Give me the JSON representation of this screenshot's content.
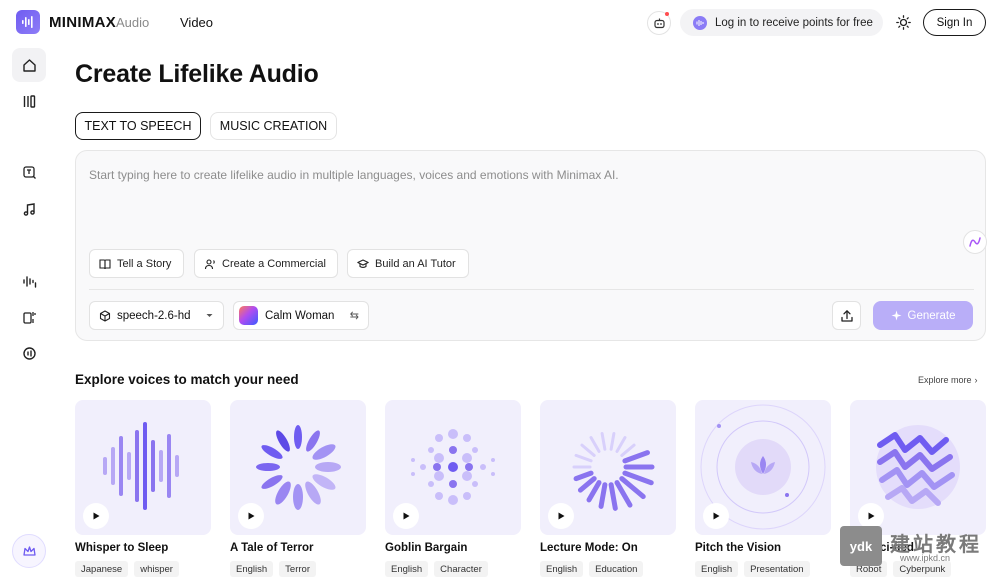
{
  "header": {
    "logo_text": "MINIMAX",
    "nav_audio": "Audio",
    "nav_video": "Video",
    "points_text": "Log in to receive points for free",
    "sign_in": "Sign In"
  },
  "page": {
    "title": "Create Lifelike Audio",
    "tabs": [
      {
        "label": "TEXT TO SPEECH",
        "active": true
      },
      {
        "label": "MUSIC CREATION",
        "active": false
      }
    ]
  },
  "editor": {
    "placeholder": "Start typing here to create lifelike audio in multiple languages, voices and emotions with Minimax AI.",
    "chips": [
      {
        "label": "Tell a Story",
        "icon": "book-icon"
      },
      {
        "label": "Create a Commercial",
        "icon": "voice-person-icon"
      },
      {
        "label": "Build an AI Tutor",
        "icon": "graduation-cap-icon"
      }
    ],
    "model": "speech-2.6-hd",
    "voice": "Calm Woman",
    "generate": "Generate"
  },
  "explore": {
    "title": "Explore voices to match your need",
    "more": "Explore more",
    "cards": [
      {
        "title": "Whisper to Sleep",
        "tags": [
          "Japanese",
          "whisper"
        ]
      },
      {
        "title": "A Tale of Terror",
        "tags": [
          "English",
          "Terror"
        ]
      },
      {
        "title": "Goblin Bargain",
        "tags": [
          "English",
          "Character"
        ]
      },
      {
        "title": "Lecture Mode: On",
        "tags": [
          "English",
          "Education"
        ]
      },
      {
        "title": "Pitch the Vision",
        "tags": [
          "English",
          "Presentation"
        ]
      },
      {
        "title": "Get Sci-fied",
        "tags": [
          "Robot",
          "Cyberpunk"
        ]
      }
    ]
  },
  "watermark": {
    "box": "ydk",
    "cn": "建站教程",
    "url": "www.ipkd.cn"
  },
  "colors": {
    "brand": "#6f5cf1",
    "accent_light": "#b9aef8",
    "card_bg": "#f1effc"
  }
}
